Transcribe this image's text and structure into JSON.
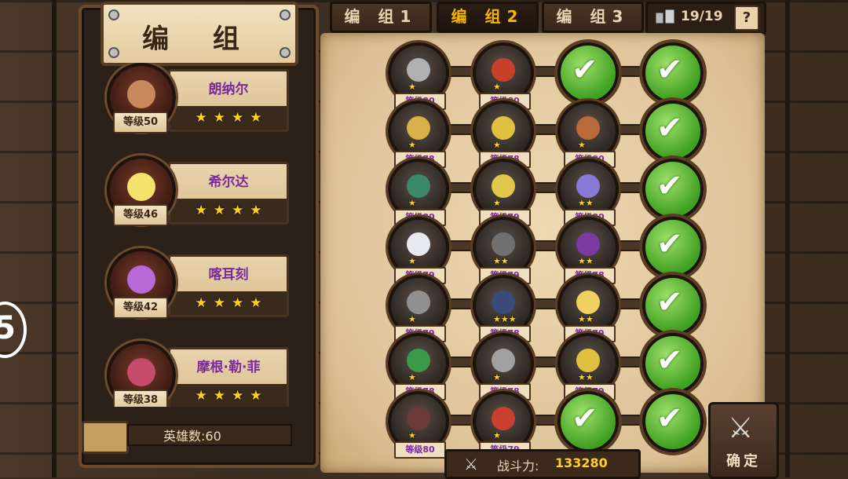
{
  "screen_title": "编 组",
  "tabs": [
    {
      "label": "编 组1",
      "active": false
    },
    {
      "label": "编 组2",
      "active": true
    },
    {
      "label": "编 组3",
      "active": false
    }
  ],
  "troop_counter": "19/19",
  "help_label": "?",
  "side_marker": "5",
  "hero_list": [
    {
      "name": "朗纳尔",
      "level": "等级50",
      "stars": 4,
      "color": "#c88a5a"
    },
    {
      "name": "希尔达",
      "level": "等级46",
      "stars": 4,
      "color": "#f4e26a"
    },
    {
      "name": "喀耳刻",
      "level": "等级42",
      "stars": 4,
      "color": "#b76ad6"
    },
    {
      "name": "摩根·勒·菲",
      "level": "等级38",
      "stars": 4,
      "color": "#c84a6a"
    }
  ],
  "hero_count": "英雄数:60",
  "formation": [
    [
      {
        "type": "hero",
        "level": "等级80",
        "stars": 1,
        "color": "#b0b0b0"
      },
      {
        "type": "hero",
        "level": "等级80",
        "stars": 1,
        "color": "#c8402a"
      },
      {
        "type": "empty"
      },
      {
        "type": "empty"
      }
    ],
    [
      {
        "type": "hero",
        "level": "等级78",
        "stars": 1,
        "color": "#d8b04a"
      },
      {
        "type": "hero",
        "level": "等级78",
        "stars": 1,
        "color": "#e0c040"
      },
      {
        "type": "hero",
        "level": "等级80",
        "stars": 1,
        "color": "#b86a3a"
      },
      {
        "type": "empty"
      }
    ],
    [
      {
        "type": "hero",
        "level": "等级80",
        "stars": 1,
        "color": "#3a8a6a"
      },
      {
        "type": "hero",
        "level": "等级79",
        "stars": 1,
        "color": "#e0c84a"
      },
      {
        "type": "hero",
        "level": "等级80",
        "stars": 2,
        "color": "#8a7ad8"
      },
      {
        "type": "empty"
      }
    ],
    [
      {
        "type": "hero",
        "level": "等级79",
        "stars": 1,
        "color": "#e8e8f0"
      },
      {
        "type": "hero",
        "level": "等级79",
        "stars": 2,
        "color": "#707070"
      },
      {
        "type": "hero",
        "level": "等级78",
        "stars": 2,
        "color": "#7a3aa0"
      },
      {
        "type": "empty"
      }
    ],
    [
      {
        "type": "hero",
        "level": "等级79",
        "stars": 1,
        "color": "#909090"
      },
      {
        "type": "hero",
        "level": "等级78",
        "stars": 3,
        "color": "#3a4a7a"
      },
      {
        "type": "hero",
        "level": "等级79",
        "stars": 2,
        "color": "#f0d060"
      },
      {
        "type": "empty"
      }
    ],
    [
      {
        "type": "hero",
        "level": "等级78",
        "stars": 1,
        "color": "#3a9a4a"
      },
      {
        "type": "hero",
        "level": "等级78",
        "stars": 1,
        "color": "#a0a0a0"
      },
      {
        "type": "hero",
        "level": "等级79",
        "stars": 2,
        "color": "#e0c040"
      },
      {
        "type": "empty"
      }
    ],
    [
      {
        "type": "hero",
        "level": "等级80",
        "stars": 1,
        "color": "#6a3a3a"
      },
      {
        "type": "hero",
        "level": "等级79",
        "stars": 1,
        "color": "#c84030"
      },
      {
        "type": "empty"
      },
      {
        "type": "empty"
      }
    ]
  ],
  "power_label": "战斗力:",
  "power_value": "133280",
  "confirm_label": "确定",
  "icons": {
    "power": "crossed-swords-icon",
    "confirm": "crossed-swords-icon",
    "check": "checkmark-icon",
    "counter": "troop-icon"
  }
}
